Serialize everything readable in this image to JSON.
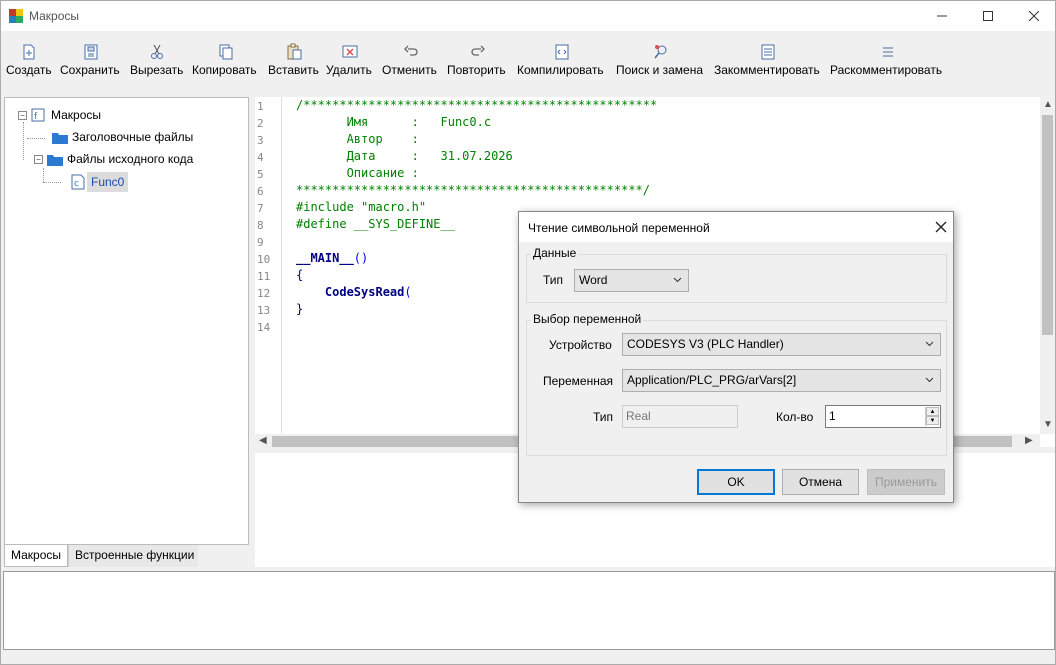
{
  "window": {
    "title": "Макросы"
  },
  "toolbar": {
    "buttons": [
      {
        "label": "Создать",
        "icon": "new-file-icon"
      },
      {
        "label": "Сохранить",
        "icon": "save-icon"
      },
      {
        "label": "Вырезать",
        "icon": "scissors-icon"
      },
      {
        "label": "Копировать",
        "icon": "copy-icon"
      },
      {
        "label": "Вставить",
        "icon": "paste-icon"
      },
      {
        "label": "Удалить",
        "icon": "delete-icon"
      },
      {
        "label": "Отменить",
        "icon": "undo-icon"
      },
      {
        "label": "Повторить",
        "icon": "redo-icon"
      },
      {
        "label": "Компилировать",
        "icon": "compile-icon"
      },
      {
        "label": "Поиск и замена",
        "icon": "search-replace-icon"
      },
      {
        "label": "Закомментировать",
        "icon": "comment-icon"
      },
      {
        "label": "Раскомментировать",
        "icon": "uncomment-icon"
      }
    ]
  },
  "tree": {
    "root": "Макросы",
    "headers": "Заголовочные файлы",
    "sources": "Файлы исходного кода",
    "file": "Func0"
  },
  "tabs": {
    "macros": "Макросы",
    "builtin": "Встроенные функции"
  },
  "editor": {
    "line_numbers": [
      "1",
      "2",
      "3",
      "4",
      "5",
      "6",
      "7",
      "8",
      "9",
      "10",
      "11",
      "12",
      "13",
      "14"
    ],
    "lines": {
      "l1": "/*************************************************",
      "l2": "       Имя      :   Func0.c",
      "l3": "       Автор    :",
      "l4": "       Дата     :   31.07.2026",
      "l5": "       Описание :",
      "l6": "************************************************/",
      "l7": "#include \"macro.h\"",
      "l8": "#define __SYS_DEFINE__",
      "l10_name": "__MAIN__",
      "l10_paren": "()",
      "l11": "{",
      "l12_name": "    CodeSysRead",
      "l12_paren": "(",
      "l13": "}"
    }
  },
  "dialog": {
    "title": "Чтение символьной переменной",
    "data_group": "Данные",
    "type_label": "Тип",
    "type_value": "Word",
    "var_group": "Выбор переменной",
    "device_label": "Устройство",
    "device_value": "CODESYS V3 (PLC Handler)",
    "variable_label": "Переменная",
    "variable_value": "Application/PLC_PRG/arVars[2]",
    "var_type_label": "Тип",
    "var_type_value": "Real",
    "count_label": "Кол-во",
    "count_value": "1",
    "ok": "OK",
    "cancel": "Отмена",
    "apply": "Применить"
  },
  "colors": {
    "accent": "#0078d7",
    "comment": "#008000",
    "keyword": "#000080"
  }
}
